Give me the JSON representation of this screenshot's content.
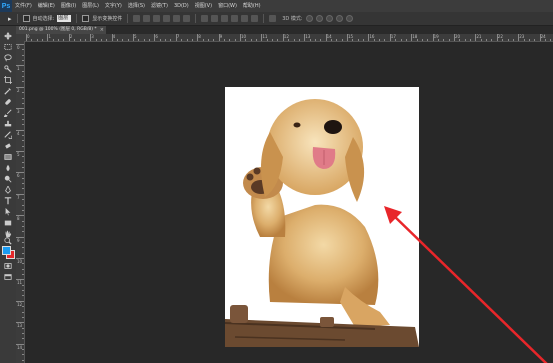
{
  "app": {
    "logo": "Ps"
  },
  "menubar": {
    "items": [
      "文件(F)",
      "编辑(E)",
      "图像(I)",
      "图层(L)",
      "文字(Y)",
      "选择(S)",
      "滤镜(T)",
      "3D(D)",
      "视图(V)",
      "窗口(W)",
      "帮助(H)"
    ]
  },
  "options": {
    "tool_glyph": "▸",
    "auto_select_label": "自动选择:",
    "auto_select_value": "图层",
    "transform_label": "显示变换控件",
    "mode_label": "3D 模式:"
  },
  "document": {
    "tab_title": "001.png @ 100% (图层 0, RGB/8) *",
    "close": "×"
  },
  "rulers": {
    "horizontal": [
      "0",
      "1",
      "2",
      "3",
      "4",
      "5",
      "6",
      "7",
      "8",
      "9",
      "10",
      "11",
      "12",
      "13",
      "14",
      "15",
      "16",
      "17",
      "18",
      "19",
      "20",
      "21",
      "22",
      "23",
      "24"
    ],
    "vertical": [
      "0",
      "1",
      "2",
      "3",
      "4",
      "5",
      "6",
      "7",
      "8",
      "9",
      "10",
      "11",
      "12",
      "13",
      "14"
    ]
  },
  "colors": {
    "foreground": "#1b9cf2",
    "background": "#e4282a",
    "annotation_arrow": "#e8262a"
  },
  "tools": [
    "move-icon",
    "marquee-icon",
    "lasso-icon",
    "quick-select-icon",
    "crop-icon",
    "eyedropper-icon",
    "healing-brush-icon",
    "brush-icon",
    "clone-stamp-icon",
    "history-brush-icon",
    "eraser-icon",
    "gradient-icon",
    "blur-icon",
    "dodge-icon",
    "pen-icon",
    "type-icon",
    "path-select-icon",
    "rectangle-icon",
    "hand-icon",
    "zoom-icon"
  ]
}
